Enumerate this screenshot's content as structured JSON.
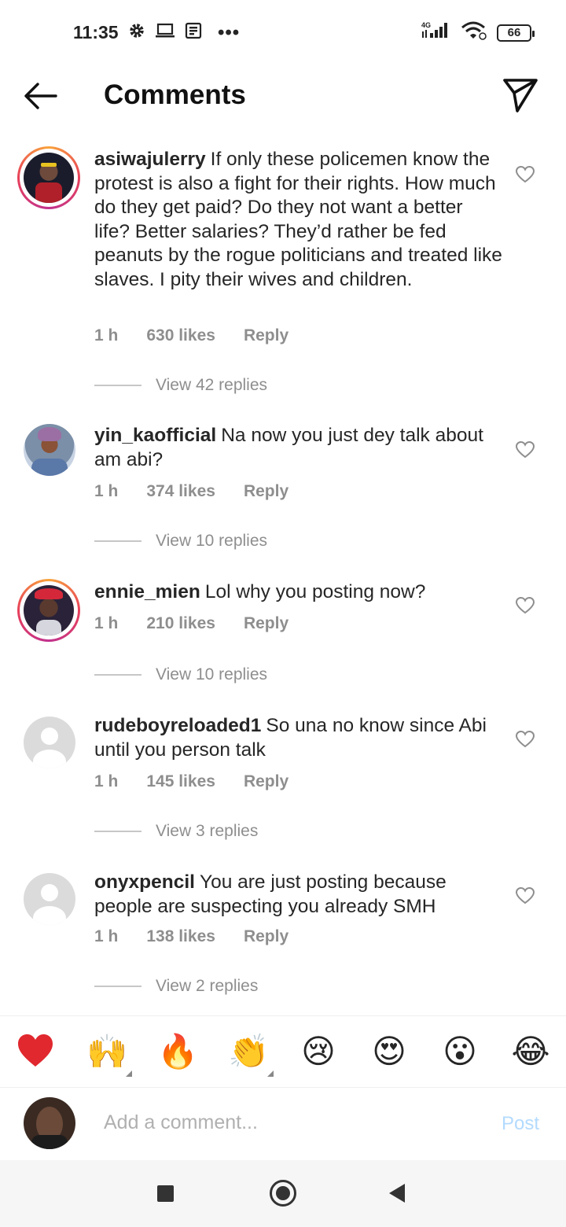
{
  "status_bar": {
    "time": "11:35",
    "network": "4G",
    "battery": "66",
    "left_icons": [
      "gear-icon",
      "laptop-icon",
      "note-icon",
      "more-dots-icon"
    ],
    "right_icons": [
      "signal-icon",
      "wifi-icon",
      "battery-icon"
    ]
  },
  "header": {
    "title": "Comments",
    "back_icon": "arrow-left-icon",
    "share_icon": "send-icon"
  },
  "comments": [
    {
      "username": "asiwajulerry",
      "text": "If only these policemen know the protest is also a fight for their rights. How much do they get paid? Do they not want a better life? Better salaries? They’d rather be fed peanuts by the rogue politicians and treated like slaves. I pity their wives and children.",
      "time": "1 h",
      "likes": "630 likes",
      "reply": "Reply",
      "view_replies": "View 42 replies",
      "story_ring": true
    },
    {
      "username": "yin_kaofficial",
      "text": "Na now you just dey talk about am abi?",
      "time": "1 h",
      "likes": "374 likes",
      "reply": "Reply",
      "view_replies": "View 10 replies",
      "story_ring": false
    },
    {
      "username": "ennie_mien",
      "text": "Lol why you posting now?",
      "time": "1 h",
      "likes": "210 likes",
      "reply": "Reply",
      "view_replies": "View 10 replies",
      "story_ring": true
    },
    {
      "username": "rudeboyreloaded1",
      "text": "So una no know since Abi until you person talk",
      "time": "1 h",
      "likes": "145 likes",
      "reply": "Reply",
      "view_replies": "View 3 replies",
      "story_ring": false
    },
    {
      "username": "onyxpencil",
      "text": "You are just posting because people are suspecting you already SMH",
      "time": "1 h",
      "likes": "138 likes",
      "reply": "Reply",
      "view_replies": "View 2 replies",
      "story_ring": false
    }
  ],
  "emoji_bar": [
    "❤️",
    "🙌",
    "🔥",
    "👏",
    "😢",
    "😍",
    "😮",
    "😂"
  ],
  "compose": {
    "placeholder": "Add a comment...",
    "post_label": "Post"
  },
  "colors": {
    "text": "#262626",
    "muted": "#8e8e8e",
    "post_disabled": "#b3dbff",
    "heart_red": "#e0282e"
  }
}
